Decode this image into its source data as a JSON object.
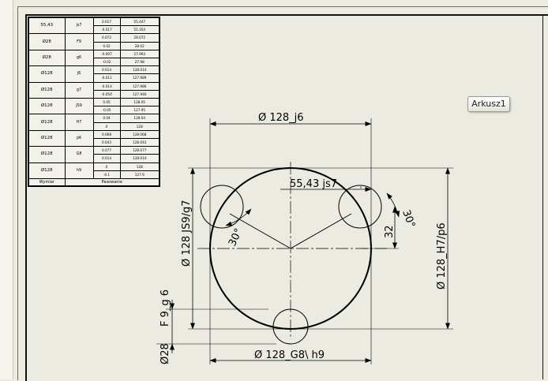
{
  "tolerance_table": {
    "rows": [
      {
        "name": "55,43",
        "cls": "js7",
        "dev": [
          "0.017",
          "-0.017"
        ],
        "lim": [
          "55.447",
          "55.354"
        ]
      },
      {
        "name": "Ø28",
        "cls": "F9",
        "dev": [
          "0.072",
          "0.02"
        ],
        "lim": [
          "28.072",
          "28.02"
        ]
      },
      {
        "name": "Ø28",
        "cls": "g6",
        "dev": [
          "-0.007",
          "-0.02"
        ],
        "lim": [
          "27.993",
          "27.98"
        ]
      },
      {
        "name": "Ø128",
        "cls": "j6",
        "dev": [
          "0.014",
          "-0.011"
        ],
        "lim": [
          "128.014",
          "127.989"
        ]
      },
      {
        "name": "Ø128",
        "cls": "g7",
        "dev": [
          "-0.014",
          "-0.054"
        ],
        "lim": [
          "127.986",
          "127.946"
        ]
      },
      {
        "name": "Ø128",
        "cls": "JS9",
        "dev": [
          "0.05",
          "-0.05"
        ],
        "lim": [
          "128.05",
          "127.95"
        ]
      },
      {
        "name": "Ø128",
        "cls": "H7",
        "dev": [
          "0.04",
          "0"
        ],
        "lim": [
          "128.04",
          "128"
        ]
      },
      {
        "name": "Ø128",
        "cls": "p6",
        "dev": [
          "0.068",
          "0.043"
        ],
        "lim": [
          "128.068",
          "128.043"
        ]
      },
      {
        "name": "Ø128",
        "cls": "G8",
        "dev": [
          "0.077",
          "0.014"
        ],
        "lim": [
          "128.077",
          "128.014"
        ]
      },
      {
        "name": "Ø128",
        "cls": "h9",
        "dev": [
          "0",
          "-0.1"
        ],
        "lim": [
          "128",
          "127.9"
        ]
      }
    ],
    "footer": {
      "label": "Wymiar",
      "value": "Pasowanie"
    }
  },
  "sheet_tab": "Arkusz1",
  "dimensions": {
    "top": "Ø 128_j6",
    "inner": "55,43 js7",
    "left": "Ø 128 JS9/g7",
    "right": "Ø 128_H7/p6",
    "bottom": "Ø 128_G8\\ h9",
    "left_lower_1": "F 9_g 6",
    "left_lower_2": "Ø28",
    "small": "32",
    "angle_left": "30°",
    "angle_right": "30°"
  }
}
